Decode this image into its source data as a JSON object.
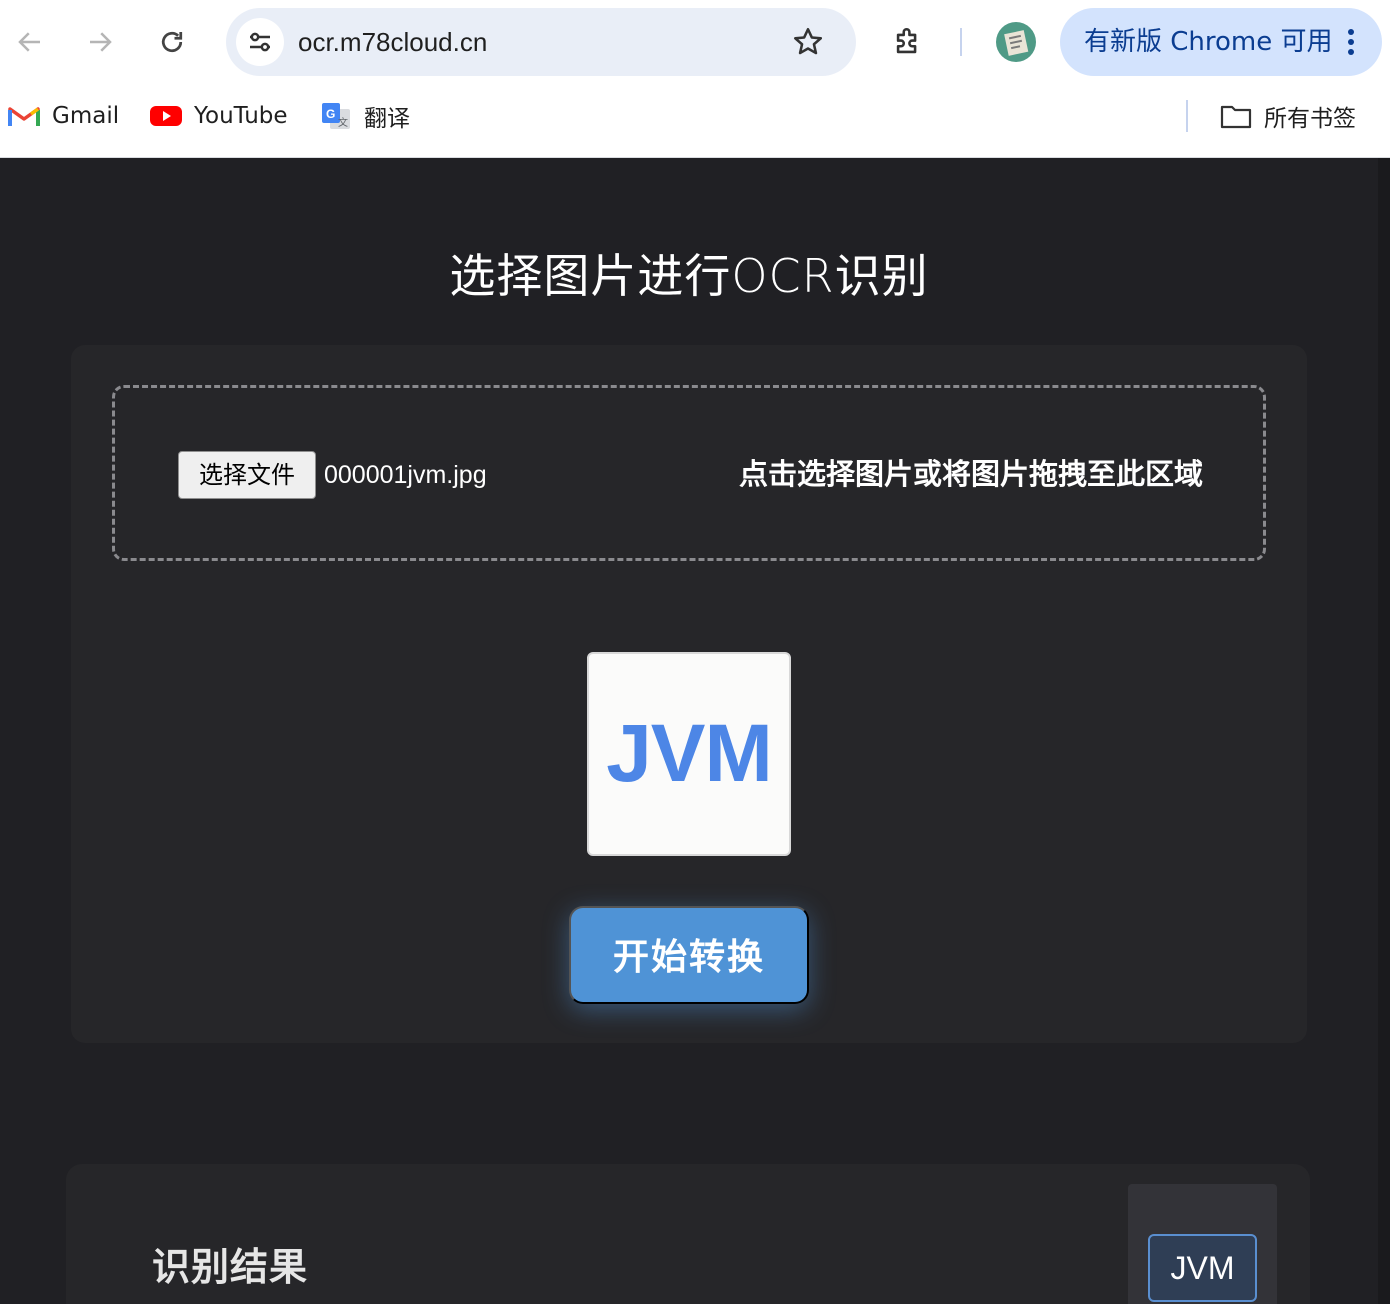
{
  "browser": {
    "url": "ocr.m78cloud.cn",
    "update_label": "有新版 Chrome 可用",
    "bookmarks": [
      {
        "label": "Gmail",
        "icon": "gmail-icon"
      },
      {
        "label": "YouTube",
        "icon": "youtube-icon"
      },
      {
        "label": "翻译",
        "icon": "google-translate-icon"
      }
    ],
    "all_bookmarks_label": "所有书签",
    "colors": {
      "omnibox_bg": "#e9eef7",
      "update_pill_bg": "#d3e3fd",
      "update_text": "#0b3d91"
    }
  },
  "page": {
    "title": "选择图片进行OCR识别",
    "upload": {
      "choose_file_label": "选择文件",
      "file_name": "000001jvm.jpg",
      "hint": "点击选择图片或将图片拖拽至此区域"
    },
    "preview_text": "JVM",
    "convert_label": "开始转换",
    "result": {
      "title": "识别结果",
      "thumb_text": "JVM"
    },
    "colors": {
      "background": "#202024",
      "card": "#262629",
      "accent": "#4f93d6",
      "preview_text": "#4d86e6"
    }
  }
}
